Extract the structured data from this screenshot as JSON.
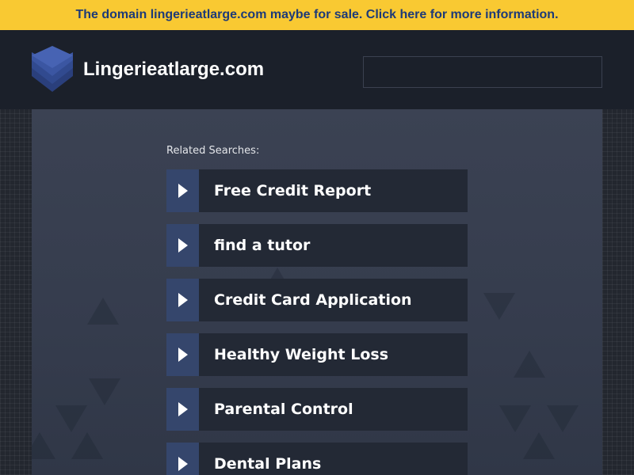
{
  "banner": {
    "text": "The domain lingerieatlarge.com maybe for sale. Click here for more information."
  },
  "header": {
    "site_title": "Lingerieatlarge.com",
    "logo_icon": "stacked-layers-icon",
    "search_placeholder": ""
  },
  "main": {
    "related_label": "Related Searches:",
    "links": [
      {
        "label": "Free Credit Report"
      },
      {
        "label": "find a tutor"
      },
      {
        "label": "Credit Card Application"
      },
      {
        "label": "Healthy Weight Loss"
      },
      {
        "label": "Parental Control"
      },
      {
        "label": "Dental Plans"
      }
    ]
  },
  "colors": {
    "banner_bg": "#f9c932",
    "banner_text": "#1d3a78",
    "header_bg": "#1b202a",
    "arrow_box": "#35466c",
    "link_bg": "#232935"
  }
}
